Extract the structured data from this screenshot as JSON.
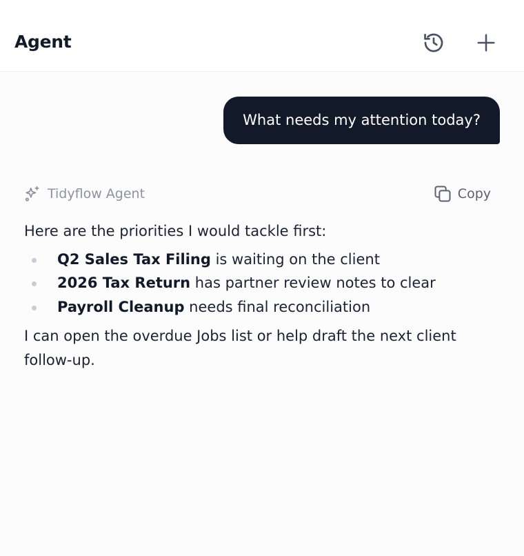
{
  "header": {
    "title": "Agent",
    "history_icon": "history-icon",
    "new_icon": "plus-icon"
  },
  "conversation": {
    "user_message": "What needs my attention today?",
    "agent": {
      "name": "Tidyflow Agent",
      "copy_label": "Copy",
      "intro": "Here are the priorities I would tackle first:",
      "items": [
        {
          "title": "Q2 Sales Tax Filing",
          "text": " is waiting on the client"
        },
        {
          "title": "2026 Tax Return",
          "text": " has partner review notes to clear"
        },
        {
          "title": "Payroll Cleanup",
          "text": " needs final reconciliation"
        }
      ],
      "outro": "I can open the overdue Jobs list or help draft the next client follow-up."
    }
  },
  "colors": {
    "user_bubble": "#121a2a",
    "background": "#fdfcfc",
    "muted_text": "#8d92a1"
  }
}
